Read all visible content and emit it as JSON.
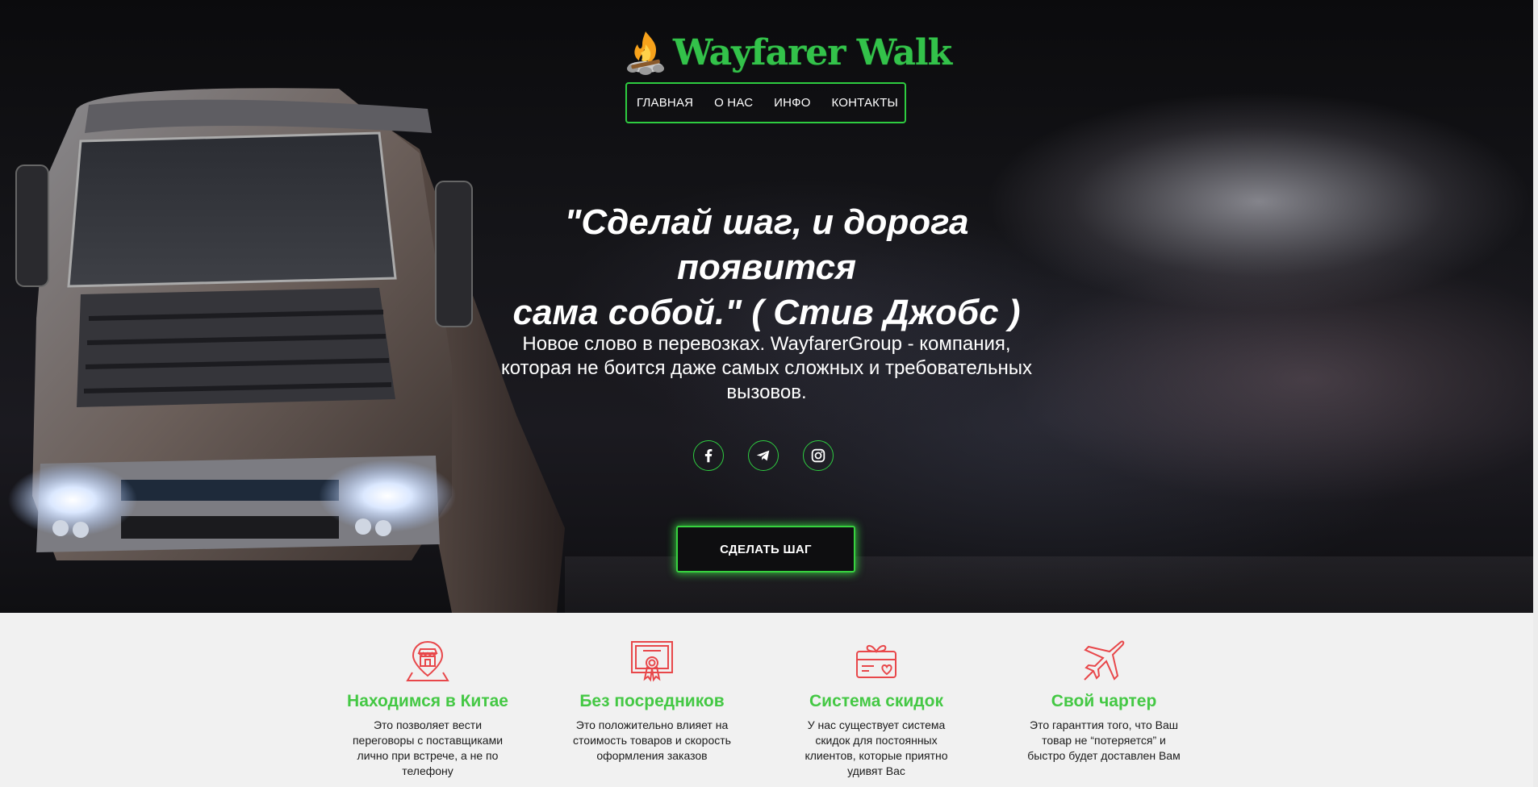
{
  "brand": {
    "name": "Wayfarer Walk",
    "accent": "#2ecc40",
    "icon": "campfire-icon"
  },
  "nav": {
    "items": [
      {
        "label": "ГЛАВНАЯ"
      },
      {
        "label": "О НАС"
      },
      {
        "label": "ИНФО"
      },
      {
        "label": "КОНТАКТЫ"
      }
    ]
  },
  "hero": {
    "quote_line1": "\"Сделай шаг, и дорога появится",
    "quote_line2": "сама собой.\" ( Стив Джобс )",
    "tagline": "Новое слово в перевозках. WayfarerGroup - компания, которая не боится даже самых сложных и требовательных вызовов.",
    "cta_label": "СДЕЛАТЬ ШАГ",
    "social": [
      {
        "icon": "facebook-icon"
      },
      {
        "icon": "telegram-icon"
      },
      {
        "icon": "instagram-icon"
      }
    ]
  },
  "features": {
    "title_color": "#44c844",
    "icon_color": "#e8474a",
    "items": [
      {
        "icon": "store-location-icon",
        "title": "Находимся в Китае",
        "desc": "Это позволяет вести переговоры с поставщиками лично при встрече, а не по телефону"
      },
      {
        "icon": "certificate-icon",
        "title": "Без посредников",
        "desc": "Это положительно влияет на стоимость товаров и скорость оформления заказов"
      },
      {
        "icon": "gift-card-icon",
        "title": "Система скидок",
        "desc": "У нас существует система скидок для постоянных клиентов, которые приятно удивят Вас"
      },
      {
        "icon": "airplane-icon",
        "title": "Свой чартер",
        "desc": "Это гаранттия того, что Ваш товар не “потеряется” и быстро будет доставлен Вам"
      }
    ]
  }
}
